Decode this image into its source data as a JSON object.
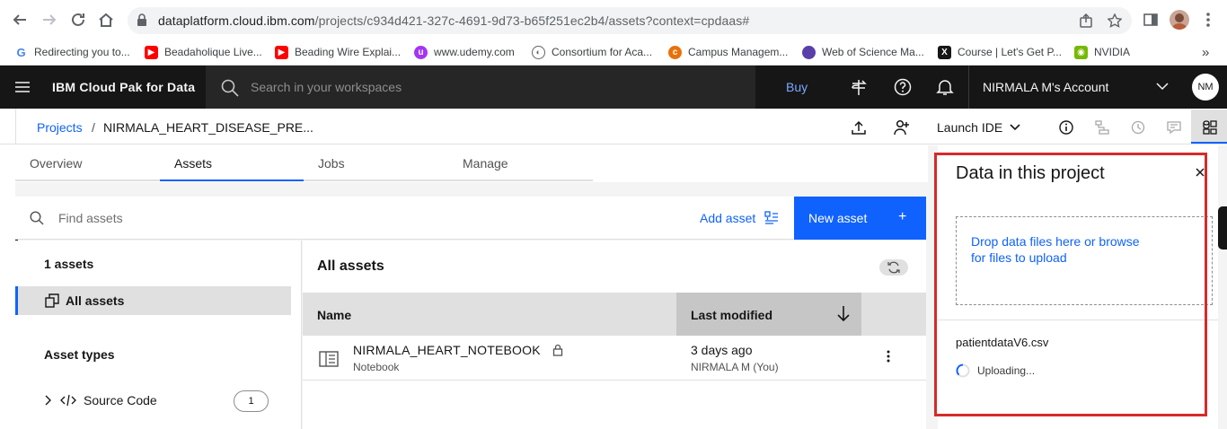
{
  "browser": {
    "url_domain": "dataplatform.cloud.ibm.com",
    "url_path": "/projects/c934d421-327c-4691-9d73-b65f251ec2b4/assets?context=cpdaas#",
    "bookmarks": [
      {
        "label": "Redirecting you to...",
        "icon": "google-icon",
        "color": "#4285f4"
      },
      {
        "label": "Beadaholique Live...",
        "icon": "youtube-icon",
        "color": "#ff0000"
      },
      {
        "label": "Beading Wire Explai...",
        "icon": "youtube-icon",
        "color": "#ff0000"
      },
      {
        "label": "www.udemy.com",
        "icon": "udemy-icon",
        "color": "#a435f0"
      },
      {
        "label": "Consortium for Aca...",
        "icon": "globe-icon",
        "color": "#5f6368"
      },
      {
        "label": "Campus Managem...",
        "icon": "campus-icon",
        "color": "#e8710a"
      },
      {
        "label": "Web of Science Ma...",
        "icon": "wos-icon",
        "color": "#5b3fa8"
      },
      {
        "label": "Course | Let's Get P...",
        "icon": "x-icon",
        "color": "#161616"
      },
      {
        "label": "NVIDIA",
        "icon": "nvidia-icon",
        "color": "#76b900"
      }
    ],
    "overflow_label": "»"
  },
  "header": {
    "product_name": "IBM Cloud Pak for Data",
    "search_placeholder": "Search in your workspaces",
    "buy_label": "Buy",
    "account_name": "NIRMALA M's Account",
    "avatar_initials": "NM"
  },
  "breadcrumb": {
    "root": "Projects",
    "separator": "/",
    "current": "NIRMALA_HEART_DISEASE_PRE..."
  },
  "toolbar": {
    "launch_ide_label": "Launch IDE"
  },
  "tabs": [
    {
      "label": "Overview",
      "active": false
    },
    {
      "label": "Assets",
      "active": true
    },
    {
      "label": "Jobs",
      "active": false
    },
    {
      "label": "Manage",
      "active": false
    }
  ],
  "assets_toolbar": {
    "find_placeholder": "Find assets",
    "add_asset_label": "Add asset",
    "new_asset_label": "New asset",
    "new_asset_plus": "+"
  },
  "left_pane": {
    "count_label": "1 assets",
    "all_assets_label": "All assets",
    "asset_types_heading": "Asset types",
    "types": [
      {
        "label": "Source Code",
        "count": "1"
      }
    ]
  },
  "right_pane": {
    "title": "All assets",
    "columns": {
      "name": "Name",
      "last_modified": "Last modified"
    },
    "rows": [
      {
        "name": "NIRMALA_HEART_NOTEBOOK",
        "type": "Notebook",
        "modified": "3 days ago",
        "modified_by": "NIRMALA M (You)"
      }
    ]
  },
  "side_panel": {
    "title": "Data in this project",
    "dropzone_text": "Drop data files here or browse for files to upload",
    "file_name": "patientdataV6.csv",
    "status": "Uploading..."
  },
  "colors": {
    "accent": "#0f62fe",
    "header_bg": "#161616",
    "highlight": "#d52b2b"
  }
}
